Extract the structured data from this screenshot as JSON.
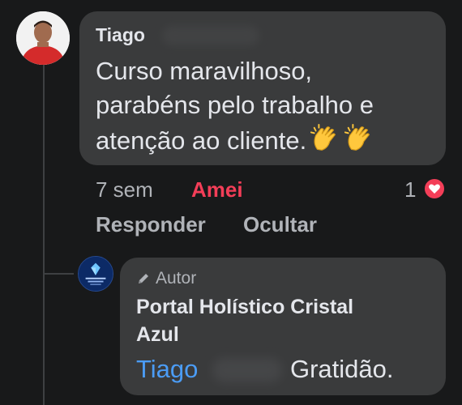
{
  "comment": {
    "author": "Tiago",
    "text_lines": [
      "Curso maravilhoso,",
      "parabéns pelo trabalho e",
      "atenção ao cliente."
    ],
    "emojis": [
      "clapping-hands-icon",
      "clapping-hands-icon"
    ],
    "time": "7 sem",
    "reaction_label": "Amei",
    "reaction_count": "1",
    "actions": {
      "reply": "Responder",
      "hide": "Ocultar"
    }
  },
  "reply": {
    "badge": "Autor",
    "author_lines": [
      "Portal Holístico Cristal",
      "Azul"
    ],
    "mention": "Tiago",
    "text": "Gratidão."
  },
  "colors": {
    "background": "#18191a",
    "bubble": "#3a3b3c",
    "love_reaction": "#f33e58",
    "mention_link": "#4b9cf5",
    "secondary_text": "#b0b3b8"
  }
}
